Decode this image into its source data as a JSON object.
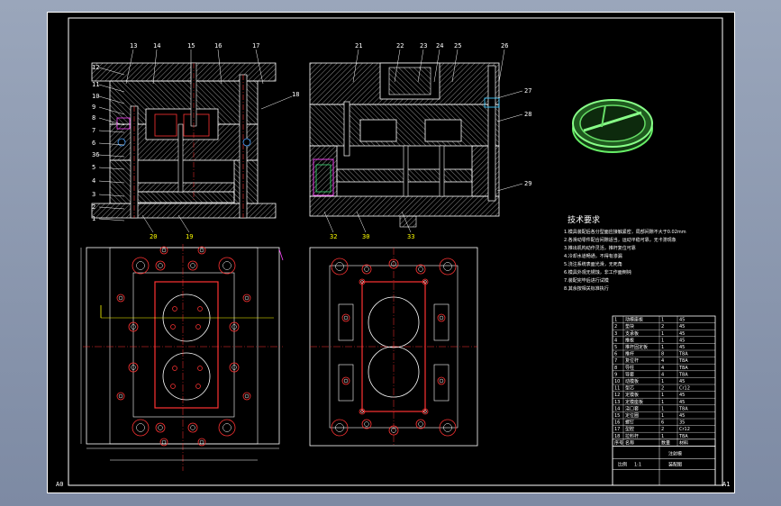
{
  "drawing": {
    "corner_labels": {
      "bottom_left": "A0",
      "bottom_right": "A1"
    },
    "section_view_a": {
      "left_callouts": [
        "12",
        "11",
        "10",
        "9",
        "8",
        "7",
        "6",
        "36",
        "5",
        "4",
        "3",
        "2",
        "1"
      ],
      "top_callouts": [
        "13",
        "14",
        "15",
        "16",
        "17"
      ],
      "right_callout": "18",
      "bottom_callouts": [
        "20",
        "19"
      ]
    },
    "section_view_b": {
      "top_callouts": [
        "21",
        "22",
        "23",
        "24",
        "25",
        "26"
      ],
      "right_callouts": [
        "27",
        "28",
        "29"
      ],
      "bottom_callouts": [
        "32",
        "30",
        "33"
      ]
    },
    "technical_requirements": {
      "title": "技术要求",
      "lines": [
        "1.模具装配后各分型面应接触紧密，局部间隙不大于0.02mm",
        "2.各滑动零件配合间隙适当，运动平稳可靠，无卡滞现象",
        "3.推出机构动作灵活，推杆复位可靠",
        "4.冷却水道畅通，不得有渗漏",
        "5.浇注系统表面光滑，无死角",
        "6.模具外观无锈蚀，非工作面倒钝",
        "7.装配完毕后进行试模",
        "8.其余按相关标准执行"
      ]
    },
    "title_block": {
      "rows": [
        [
          "1",
          "动模座板",
          "1",
          "45"
        ],
        [
          "2",
          "垫块",
          "2",
          "45"
        ],
        [
          "3",
          "支承板",
          "1",
          "45"
        ],
        [
          "4",
          "推板",
          "1",
          "45"
        ],
        [
          "5",
          "推杆固定板",
          "1",
          "45"
        ],
        [
          "6",
          "推杆",
          "8",
          "T8A"
        ],
        [
          "7",
          "复位杆",
          "4",
          "T8A"
        ],
        [
          "8",
          "导柱",
          "4",
          "T8A"
        ],
        [
          "9",
          "导套",
          "4",
          "T8A"
        ],
        [
          "10",
          "动模板",
          "1",
          "45"
        ],
        [
          "11",
          "型芯",
          "2",
          "Cr12"
        ],
        [
          "12",
          "定模板",
          "1",
          "45"
        ],
        [
          "13",
          "定模座板",
          "1",
          "45"
        ],
        [
          "14",
          "浇口套",
          "1",
          "T8A"
        ],
        [
          "15",
          "定位圈",
          "1",
          "45"
        ],
        [
          "16",
          "螺钉",
          "6",
          "35"
        ],
        [
          "17",
          "型腔",
          "2",
          "Cr12"
        ],
        [
          "18",
          "拉料杆",
          "1",
          "T8A"
        ]
      ],
      "header": [
        "序号",
        "名称",
        "数量",
        "材料"
      ],
      "bottom_labels": [
        "注射模",
        "装配图",
        "比例",
        "1:1"
      ]
    }
  }
}
